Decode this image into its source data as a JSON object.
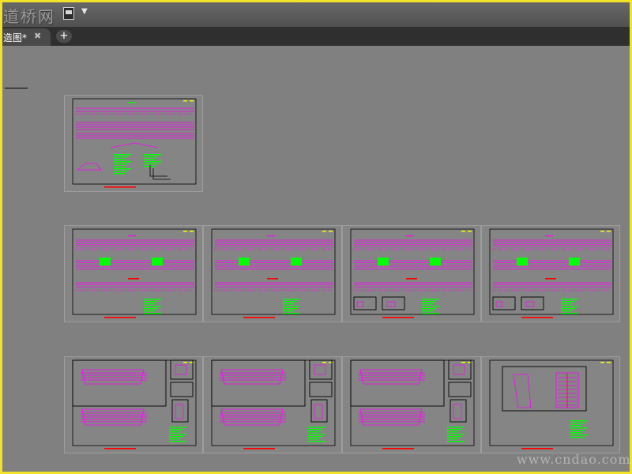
{
  "app": {
    "logo_text": "道桥网",
    "quick_access_icons": [
      "floppy-save-icon",
      "dropdown-arrow-icon"
    ],
    "dropdown_glyph": "▼"
  },
  "tabs": [
    {
      "label": "造图*",
      "close_glyph": "✖",
      "active": true
    }
  ],
  "add_tab_glyph": "+",
  "watermark": "www.cndao.com",
  "colors": {
    "background": "#808080",
    "drawing_magenta": "#ff00ff",
    "drawing_green": "#00ff00",
    "drawing_red": "#ff0000",
    "drawing_yellow": "#ffff00",
    "frame_yellow": "#f2e22a"
  },
  "layout_sheets": [
    {
      "kind": "plan-elevation"
    },
    {
      "kind": "longitudinal"
    },
    {
      "kind": "longitudinal"
    },
    {
      "kind": "longitudinal-with-details"
    },
    {
      "kind": "longitudinal-with-details"
    },
    {
      "kind": "cross-section-details"
    },
    {
      "kind": "cross-section-details"
    },
    {
      "kind": "cross-section-details"
    },
    {
      "kind": "pier-details"
    }
  ]
}
